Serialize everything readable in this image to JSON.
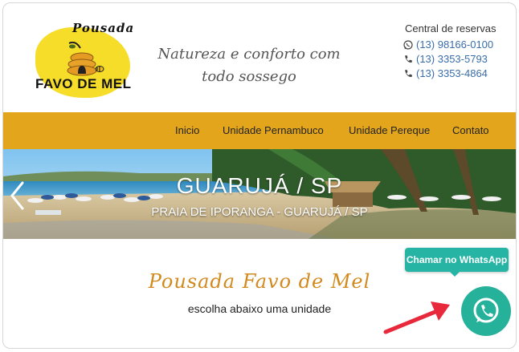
{
  "logo": {
    "line1": "Pousada",
    "line2": "FAVO DE MEL"
  },
  "tagline": {
    "line1": "Natureza e conforto com",
    "line2": "todo sossego"
  },
  "reservations": {
    "title": "Central de reservas",
    "phones": [
      {
        "icon": "whatsapp-icon",
        "number": "(13) 98166-0100"
      },
      {
        "icon": "phone-icon",
        "number": "(13) 3353-5793"
      },
      {
        "icon": "phone-icon",
        "number": "(13) 3353-4864"
      }
    ]
  },
  "nav": {
    "items": [
      {
        "label": "Inicio"
      },
      {
        "label": "Unidade Pernambuco"
      },
      {
        "label": "Unidade Pereque"
      },
      {
        "label": "Contato"
      }
    ]
  },
  "banner": {
    "title": "GUARUJÁ / SP",
    "subtitle": "PRAIA DE IPORANGA - GUARUJÁ / SP"
  },
  "content": {
    "title": "Pousada Favo de Mel",
    "subtitle": "escolha abaixo uma unidade"
  },
  "whatsapp": {
    "tooltip": "Chamar no WhatsApp"
  },
  "colors": {
    "nav": "#e3a51c",
    "accent": "#d28a1d",
    "whatsapp": "#25b19a",
    "link": "#3a6eaa",
    "arrow": "#e8293c"
  }
}
